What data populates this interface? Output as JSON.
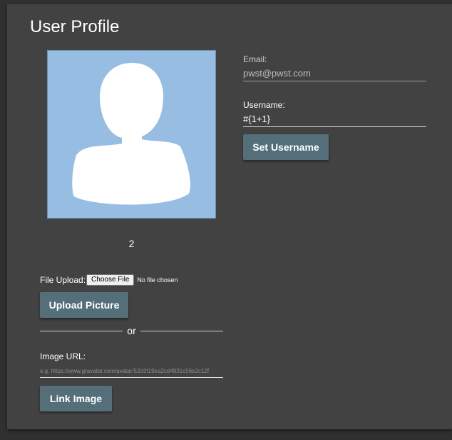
{
  "page": {
    "title": "User Profile"
  },
  "avatar": {
    "icon": "user-silhouette-icon",
    "background_color": "#98bde2",
    "counter": "2"
  },
  "upload": {
    "label": "File Upload:",
    "choose_label": "Choose File",
    "status": "No file chosen",
    "button_label": "Upload Picture"
  },
  "divider": {
    "text": "or"
  },
  "image_url": {
    "label": "Image URL:",
    "placeholder": "e.g. https://www.gravatar.com/avatar/52d3f19ea2cd4831c56e2c12f",
    "button_label": "Link Image"
  },
  "email": {
    "label": "Email:",
    "value": "pwst@pwst.com"
  },
  "username": {
    "label": "Username:",
    "value": "#{1+1}",
    "button_label": "Set Username"
  },
  "colors": {
    "card_background": "#424242",
    "page_background": "#303030",
    "button": "#546e7a"
  }
}
